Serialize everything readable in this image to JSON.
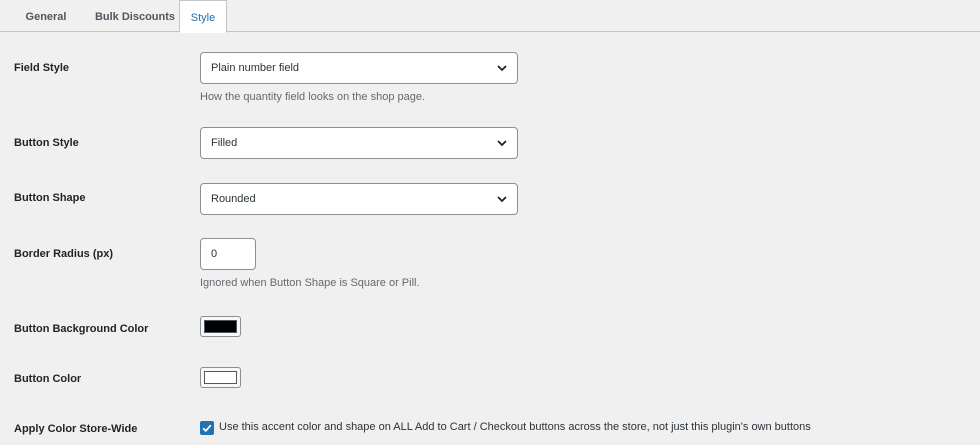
{
  "tabs": [
    {
      "label": "General"
    },
    {
      "label": "Bulk Discounts"
    },
    {
      "label": "Style"
    }
  ],
  "field_style": {
    "label": "Field Style",
    "value": "Plain number field",
    "description": "How the quantity field looks on the shop page."
  },
  "button_style": {
    "label": "Button Style",
    "value": "Filled"
  },
  "button_shape": {
    "label": "Button Shape",
    "value": "Rounded"
  },
  "border_radius": {
    "label": "Border Radius (px)",
    "value": "0",
    "description": "Ignored when Button Shape is Square or Pill."
  },
  "button_background_color": {
    "label": "Button Background Color",
    "color": "#000000"
  },
  "button_color": {
    "label": "Button Color",
    "color": "#ffffff"
  },
  "apply_store_wide": {
    "label": "Apply Color Store-Wide",
    "checked": true,
    "checkbox_label": "Use this accent color and shape on ALL Add to Cart / Checkout buttons across the store, not just this plugin's own buttons"
  },
  "colors": {
    "accent": "#2271b1",
    "page_bg": "#f0f0f1"
  }
}
